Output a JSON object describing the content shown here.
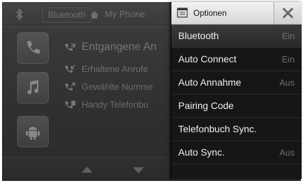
{
  "topbar": {
    "bluetooth_tab": "Bluetooth",
    "myphone_tab": "My Phone"
  },
  "call_list": [
    {
      "label": "Entgangene An"
    },
    {
      "label": "Erhaltene Anrufe"
    },
    {
      "label": "Gewählte Numme"
    },
    {
      "label": "Handy Telefonbu"
    }
  ],
  "options_menu": {
    "title": "Optionen",
    "items": [
      {
        "label": "Bluetooth",
        "value": "Ein"
      },
      {
        "label": "Auto Connect",
        "value": "Ein"
      },
      {
        "label": "Auto Annahme",
        "value": "Aus"
      },
      {
        "label": "Pairing Code",
        "value": ""
      },
      {
        "label": "Telefonbuch Sync.",
        "value": ""
      },
      {
        "label": "Auto Sync.",
        "value": "Aus"
      }
    ]
  },
  "icons": {
    "bluetooth": "bluetooth-icon",
    "home": "home-icon",
    "close": "close-icon",
    "menu": "menu-list-icon",
    "phone_tile": "phone-icon",
    "music_tile": "music-note-icon",
    "android_tile": "android-icon",
    "up": "arrow-up-icon",
    "down": "arrow-down-icon"
  }
}
